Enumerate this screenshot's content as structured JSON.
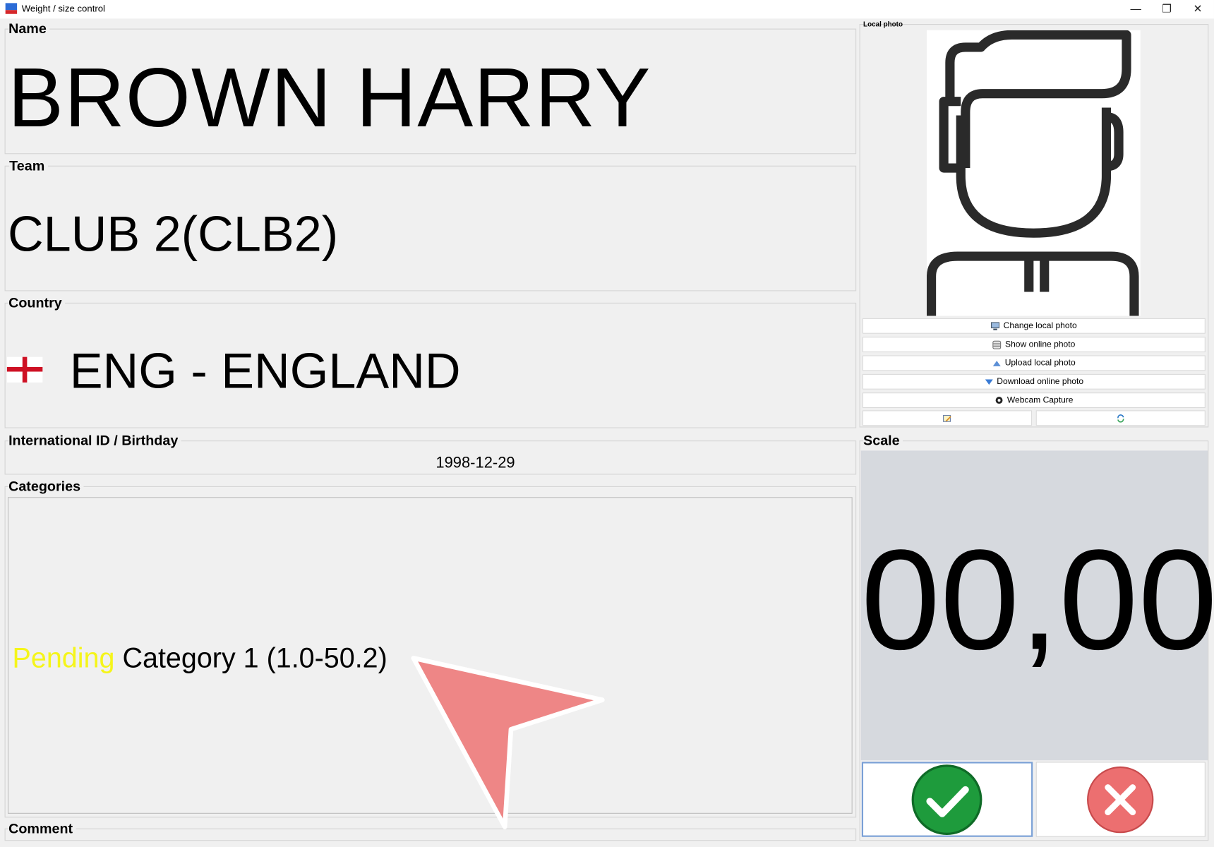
{
  "window": {
    "title": "Weight / size control",
    "minimize_glyph": "—",
    "restore_glyph": "❐",
    "close_glyph": "✕"
  },
  "name": {
    "label": "Name",
    "value": "BROWN HARRY"
  },
  "team": {
    "label": "Team",
    "value": "CLUB 2(CLB2)"
  },
  "country": {
    "label": "Country",
    "value": "ENG - ENGLAND",
    "flag_icon": "england-flag-icon"
  },
  "id_birthday": {
    "label": "International ID / Birthday",
    "value": "1998-12-29"
  },
  "categories": {
    "label": "Categories",
    "items": [
      {
        "status": "Pending",
        "name": "Category 1 (1.0-50.2)",
        "status_color": "#f5f51a"
      }
    ]
  },
  "comment": {
    "label": "Comment"
  },
  "photo": {
    "label": "Local photo",
    "buttons": [
      {
        "label": "Change local photo",
        "icon": "monitor-icon"
      },
      {
        "label": "Show online photo",
        "icon": "database-icon"
      },
      {
        "label": "Upload local photo",
        "icon": "upload-arrow-icon"
      },
      {
        "label": "Download online photo",
        "icon": "download-arrow-icon"
      },
      {
        "label": "Webcam Capture",
        "icon": "webcam-icon"
      }
    ],
    "extra_buttons": [
      {
        "icon": "edit-note-icon"
      },
      {
        "icon": "refresh-icon"
      }
    ]
  },
  "scale": {
    "label": "Scale",
    "value": "00,00"
  },
  "actions": {
    "confirm_icon": "check-icon",
    "confirm_color": "#1e9b3c",
    "cancel_icon": "close-x-icon",
    "cancel_color": "#ec6f70"
  }
}
